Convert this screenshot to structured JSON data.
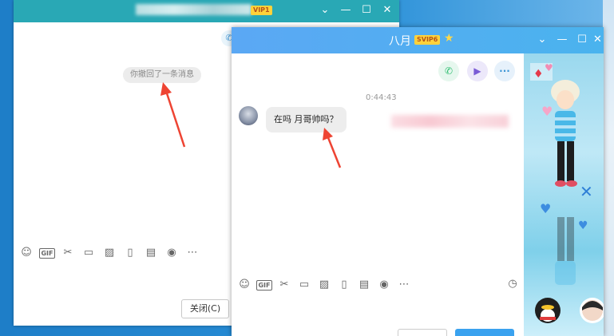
{
  "back_window": {
    "vip_badge": "VIP1",
    "recall_notice": "你撤回了一条消息",
    "close_button": "关闭(C)",
    "toolbar": [
      "emoji-icon",
      "gif-icon",
      "scissors-icon",
      "folder-icon",
      "image-icon",
      "vibrate-icon",
      "red-packet-icon",
      "music-icon",
      "more-icon"
    ],
    "gif_label": "GIF"
  },
  "front_window": {
    "contact_name": "八月",
    "vip_badge": "SVIP6",
    "timestamp": "0:44:43",
    "message": "在吗 月哥帅吗？",
    "gif_label": "GIF",
    "toolbar": [
      "emoji-icon",
      "gif-icon",
      "scissors-icon",
      "folder-icon",
      "image-icon",
      "vibrate-icon",
      "red-packet-icon",
      "music-icon",
      "more-icon"
    ],
    "actions": [
      "phone-icon",
      "video-icon",
      "more-dots-icon"
    ]
  },
  "colors": {
    "back_title": "#29a8b5",
    "front_title": "#5ba8f4",
    "arrow": "#ee4433",
    "vip_badge": "#ffd23b",
    "phone_green": "#2fbf71",
    "video_purple": "#7a5bd6",
    "more_blue": "#3d96d6"
  }
}
